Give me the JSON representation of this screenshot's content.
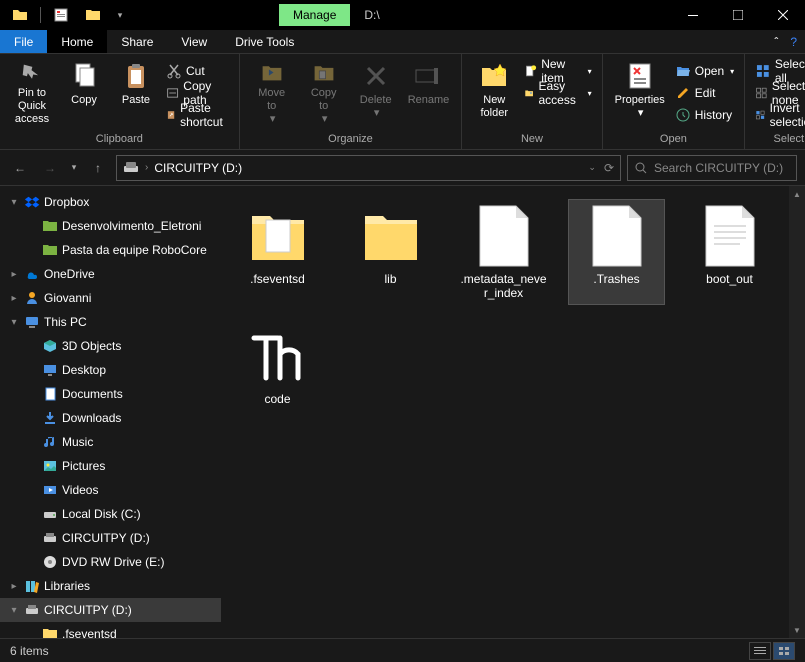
{
  "titlebar": {
    "manage_label": "Manage",
    "path": "D:\\"
  },
  "tabs": {
    "file": "File",
    "home": "Home",
    "share": "Share",
    "view": "View",
    "drive_tools": "Drive Tools"
  },
  "ribbon": {
    "pin": "Pin to Quick\naccess",
    "copy": "Copy",
    "paste": "Paste",
    "cut": "Cut",
    "copy_path": "Copy path",
    "paste_shortcut": "Paste shortcut",
    "clipboard": "Clipboard",
    "move_to": "Move\nto",
    "copy_to": "Copy\nto",
    "delete": "Delete",
    "rename": "Rename",
    "organize": "Organize",
    "new_folder": "New\nfolder",
    "new_item": "New item",
    "easy_access": "Easy access",
    "new": "New",
    "properties": "Properties",
    "open": "Open",
    "edit": "Edit",
    "history": "History",
    "open_group": "Open",
    "select_all": "Select all",
    "select_none": "Select none",
    "invert_selection": "Invert selection",
    "select": "Select"
  },
  "nav": {
    "location": "CIRCUITPY (D:)",
    "search_placeholder": "Search CIRCUITPY (D:)"
  },
  "tree": [
    {
      "label": "Dropbox",
      "icon": "dropbox",
      "indent": 0,
      "exp": "▾"
    },
    {
      "label": "Desenvolvimento_Eletroni",
      "icon": "folder-green",
      "indent": 1,
      "exp": ""
    },
    {
      "label": "Pasta da equipe RoboCore",
      "icon": "folder-green",
      "indent": 1,
      "exp": ""
    },
    {
      "label": "OneDrive",
      "icon": "onedrive",
      "indent": 0,
      "exp": "▸"
    },
    {
      "label": "Giovanni",
      "icon": "user",
      "indent": 0,
      "exp": "▸"
    },
    {
      "label": "This PC",
      "icon": "pc",
      "indent": 0,
      "exp": "▾"
    },
    {
      "label": "3D Objects",
      "icon": "3d",
      "indent": 1,
      "exp": ""
    },
    {
      "label": "Desktop",
      "icon": "desktop",
      "indent": 1,
      "exp": ""
    },
    {
      "label": "Documents",
      "icon": "documents",
      "indent": 1,
      "exp": ""
    },
    {
      "label": "Downloads",
      "icon": "downloads",
      "indent": 1,
      "exp": ""
    },
    {
      "label": "Music",
      "icon": "music",
      "indent": 1,
      "exp": ""
    },
    {
      "label": "Pictures",
      "icon": "pictures",
      "indent": 1,
      "exp": ""
    },
    {
      "label": "Videos",
      "icon": "videos",
      "indent": 1,
      "exp": ""
    },
    {
      "label": "Local Disk (C:)",
      "icon": "disk",
      "indent": 1,
      "exp": ""
    },
    {
      "label": "CIRCUITPY (D:)",
      "icon": "usb",
      "indent": 1,
      "exp": ""
    },
    {
      "label": "DVD RW Drive (E:)",
      "icon": "dvd",
      "indent": 1,
      "exp": ""
    },
    {
      "label": "Libraries",
      "icon": "libraries",
      "indent": 0,
      "exp": "▸"
    },
    {
      "label": "CIRCUITPY (D:)",
      "icon": "usb",
      "indent": 0,
      "exp": "▾",
      "selected": true
    },
    {
      "label": ".fseventsd",
      "icon": "folder",
      "indent": 1,
      "exp": ""
    }
  ],
  "items": [
    {
      "label": ".fseventsd",
      "type": "folder-doc",
      "selected": false
    },
    {
      "label": "lib",
      "type": "folder",
      "selected": false
    },
    {
      "label": ".metadata_never_index",
      "type": "file",
      "selected": false
    },
    {
      "label": ".Trashes",
      "type": "file",
      "selected": true
    },
    {
      "label": "boot_out",
      "type": "text",
      "selected": false
    },
    {
      "label": "code",
      "type": "thonny",
      "selected": false
    }
  ],
  "status": {
    "count": "6 items"
  }
}
